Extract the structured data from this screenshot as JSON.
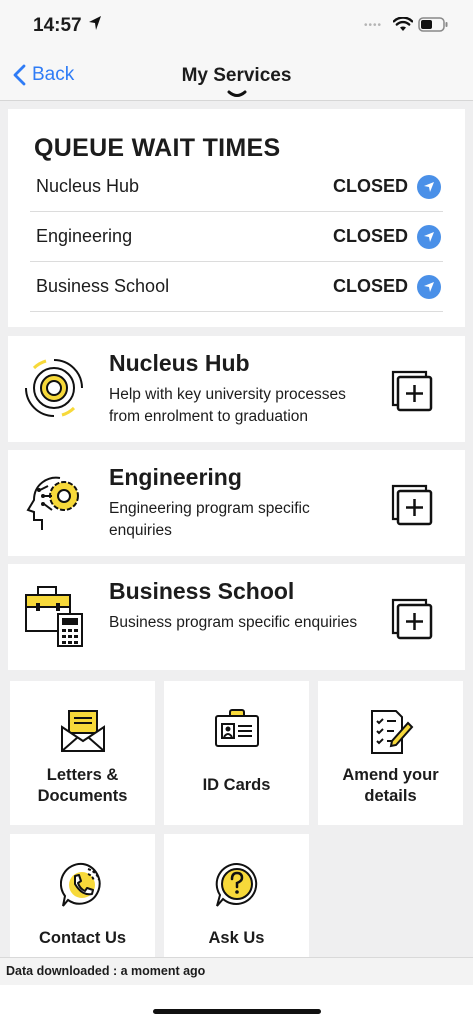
{
  "status_bar": {
    "time": "14:57",
    "dots": "••••"
  },
  "nav": {
    "back_label": "Back",
    "title": "My Services"
  },
  "queue": {
    "heading": "QUEUE WAIT TIMES",
    "rows": [
      {
        "name": "Nucleus Hub",
        "status": "CLOSED"
      },
      {
        "name": "Engineering",
        "status": "CLOSED"
      },
      {
        "name": "Business School",
        "status": "CLOSED"
      }
    ]
  },
  "services": [
    {
      "title": "Nucleus Hub",
      "description": "Help with key university processes from enrolment to graduation",
      "icon": "target-rings-icon"
    },
    {
      "title": "Engineering",
      "description": "Engineering program specific enquiries",
      "icon": "head-gear-icon"
    },
    {
      "title": "Business School",
      "description": "Business program specific enquiries",
      "icon": "briefcase-calculator-icon"
    }
  ],
  "tiles": [
    {
      "label": "Letters & Documents",
      "icon": "envelope-letter-icon"
    },
    {
      "label": "ID Cards",
      "icon": "id-card-icon"
    },
    {
      "label": "Amend your details",
      "icon": "checklist-pen-icon"
    },
    {
      "label": "Contact Us",
      "icon": "phone-bubble-icon"
    },
    {
      "label": "Ask Us",
      "icon": "question-bubble-icon"
    }
  ],
  "footer": {
    "text": "Data downloaded : a moment ago"
  },
  "colors": {
    "accent": "#2f7cf6",
    "status_arrow": "#4a90e8",
    "brand_yellow": "#f7d93a"
  }
}
